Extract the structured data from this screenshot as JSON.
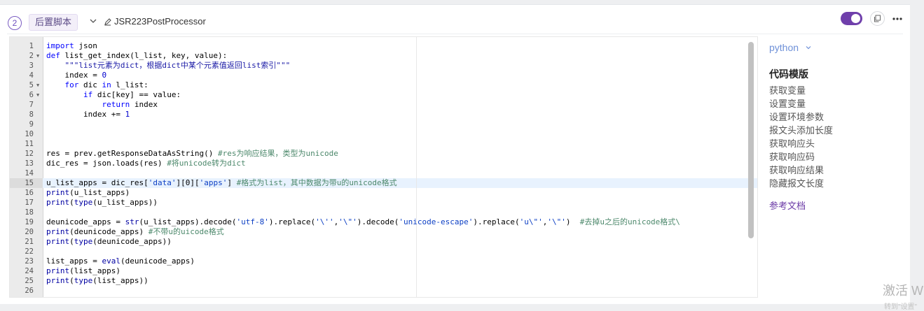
{
  "header": {
    "step_number": "2",
    "type_tag": "后置脚本",
    "processor_name": "JSR223PostProcessor",
    "enabled": true
  },
  "editor": {
    "lines": [
      {
        "n": "1",
        "fold": false,
        "html": "<span class=\"kw\">import</span> json"
      },
      {
        "n": "2",
        "fold": true,
        "html": "<span class=\"kw\">def</span> list_get_index(l_list, key, value):"
      },
      {
        "n": "3",
        "fold": false,
        "html": "    <span class=\"str2\">\"\"\"list元素为dict，根据dict中某个元素值返回list索引\"\"\"</span>"
      },
      {
        "n": "4",
        "fold": false,
        "html": "    index = <span class=\"num\">0</span>"
      },
      {
        "n": "5",
        "fold": true,
        "html": "    <span class=\"kw\">for</span> dic <span class=\"kw\">in</span> l_list:"
      },
      {
        "n": "6",
        "fold": true,
        "html": "        <span class=\"kw\">if</span> dic[key] == value:"
      },
      {
        "n": "7",
        "fold": false,
        "html": "            <span class=\"kw\">return</span> index"
      },
      {
        "n": "8",
        "fold": false,
        "html": "        index += <span class=\"num\">1</span>"
      },
      {
        "n": "9",
        "fold": false,
        "html": ""
      },
      {
        "n": "10",
        "fold": false,
        "html": ""
      },
      {
        "n": "11",
        "fold": false,
        "html": ""
      },
      {
        "n": "12",
        "fold": false,
        "html": "res = prev.getResponseDataAsString() <span class=\"cm\">#res为响应结果，类型为unicode</span>"
      },
      {
        "n": "13",
        "fold": false,
        "html": "dic_res = json.loads(res) <span class=\"cm\">#将unicode转为dict</span>"
      },
      {
        "n": "14",
        "fold": false,
        "html": ""
      },
      {
        "n": "15",
        "fold": false,
        "html": "u_list_apps = dic_res[<span class=\"str\">'data'</span>][0][<span class=\"str\">'apps'</span>] <span class=\"cm\">#格式为list，其中数据为带u的unicode格式</span>"
      },
      {
        "n": "16",
        "fold": false,
        "html": "<span class=\"kw2\">print</span>(u_list_apps)"
      },
      {
        "n": "17",
        "fold": false,
        "html": "<span class=\"kw2\">print</span>(<span class=\"kw2\">type</span>(u_list_apps))"
      },
      {
        "n": "18",
        "fold": false,
        "html": ""
      },
      {
        "n": "19",
        "fold": false,
        "html": "deunicode_apps = <span class=\"kw2\">str</span>(u_list_apps).decode(<span class=\"str\">'utf-8'</span>).replace(<span class=\"str\">'\\''</span>,<span class=\"str\">'\\\"'</span>).decode(<span class=\"str\">'unicode-escape'</span>).replace(<span class=\"str\">'u\\\"'</span>,<span class=\"str\">'\\\"'</span>)  <span class=\"cm\">#去掉u之后的unicode格式\\</span>"
      },
      {
        "n": "20",
        "fold": false,
        "html": "<span class=\"kw2\">print</span>(deunicode_apps) <span class=\"cm\">#不带u的uicode格式</span>"
      },
      {
        "n": "21",
        "fold": false,
        "html": "<span class=\"kw2\">print</span>(<span class=\"kw2\">type</span>(deunicode_apps))"
      },
      {
        "n": "22",
        "fold": false,
        "html": ""
      },
      {
        "n": "23",
        "fold": false,
        "html": "list_apps = <span class=\"kw2\">eval</span>(deunicode_apps)"
      },
      {
        "n": "24",
        "fold": false,
        "html": "<span class=\"kw2\">print</span>(list_apps)"
      },
      {
        "n": "25",
        "fold": false,
        "html": "<span class=\"kw2\">print</span>(<span class=\"kw2\">type</span>(list_apps))"
      },
      {
        "n": "26",
        "fold": false,
        "html": ""
      }
    ]
  },
  "side_panel": {
    "language": "python",
    "templates_title": "代码模版",
    "templates": [
      "获取变量",
      "设置变量",
      "设置环境参数",
      "报文头添加长度",
      "获取响应头",
      "获取响应码",
      "获取响应结果",
      "隐藏报文长度"
    ],
    "reference_link": "参考文档"
  },
  "watermark": {
    "line1": "激活 W",
    "line2": "转到\"设置\""
  },
  "colors": {
    "accent": "#6f3fab",
    "link": "#6e90d8"
  }
}
